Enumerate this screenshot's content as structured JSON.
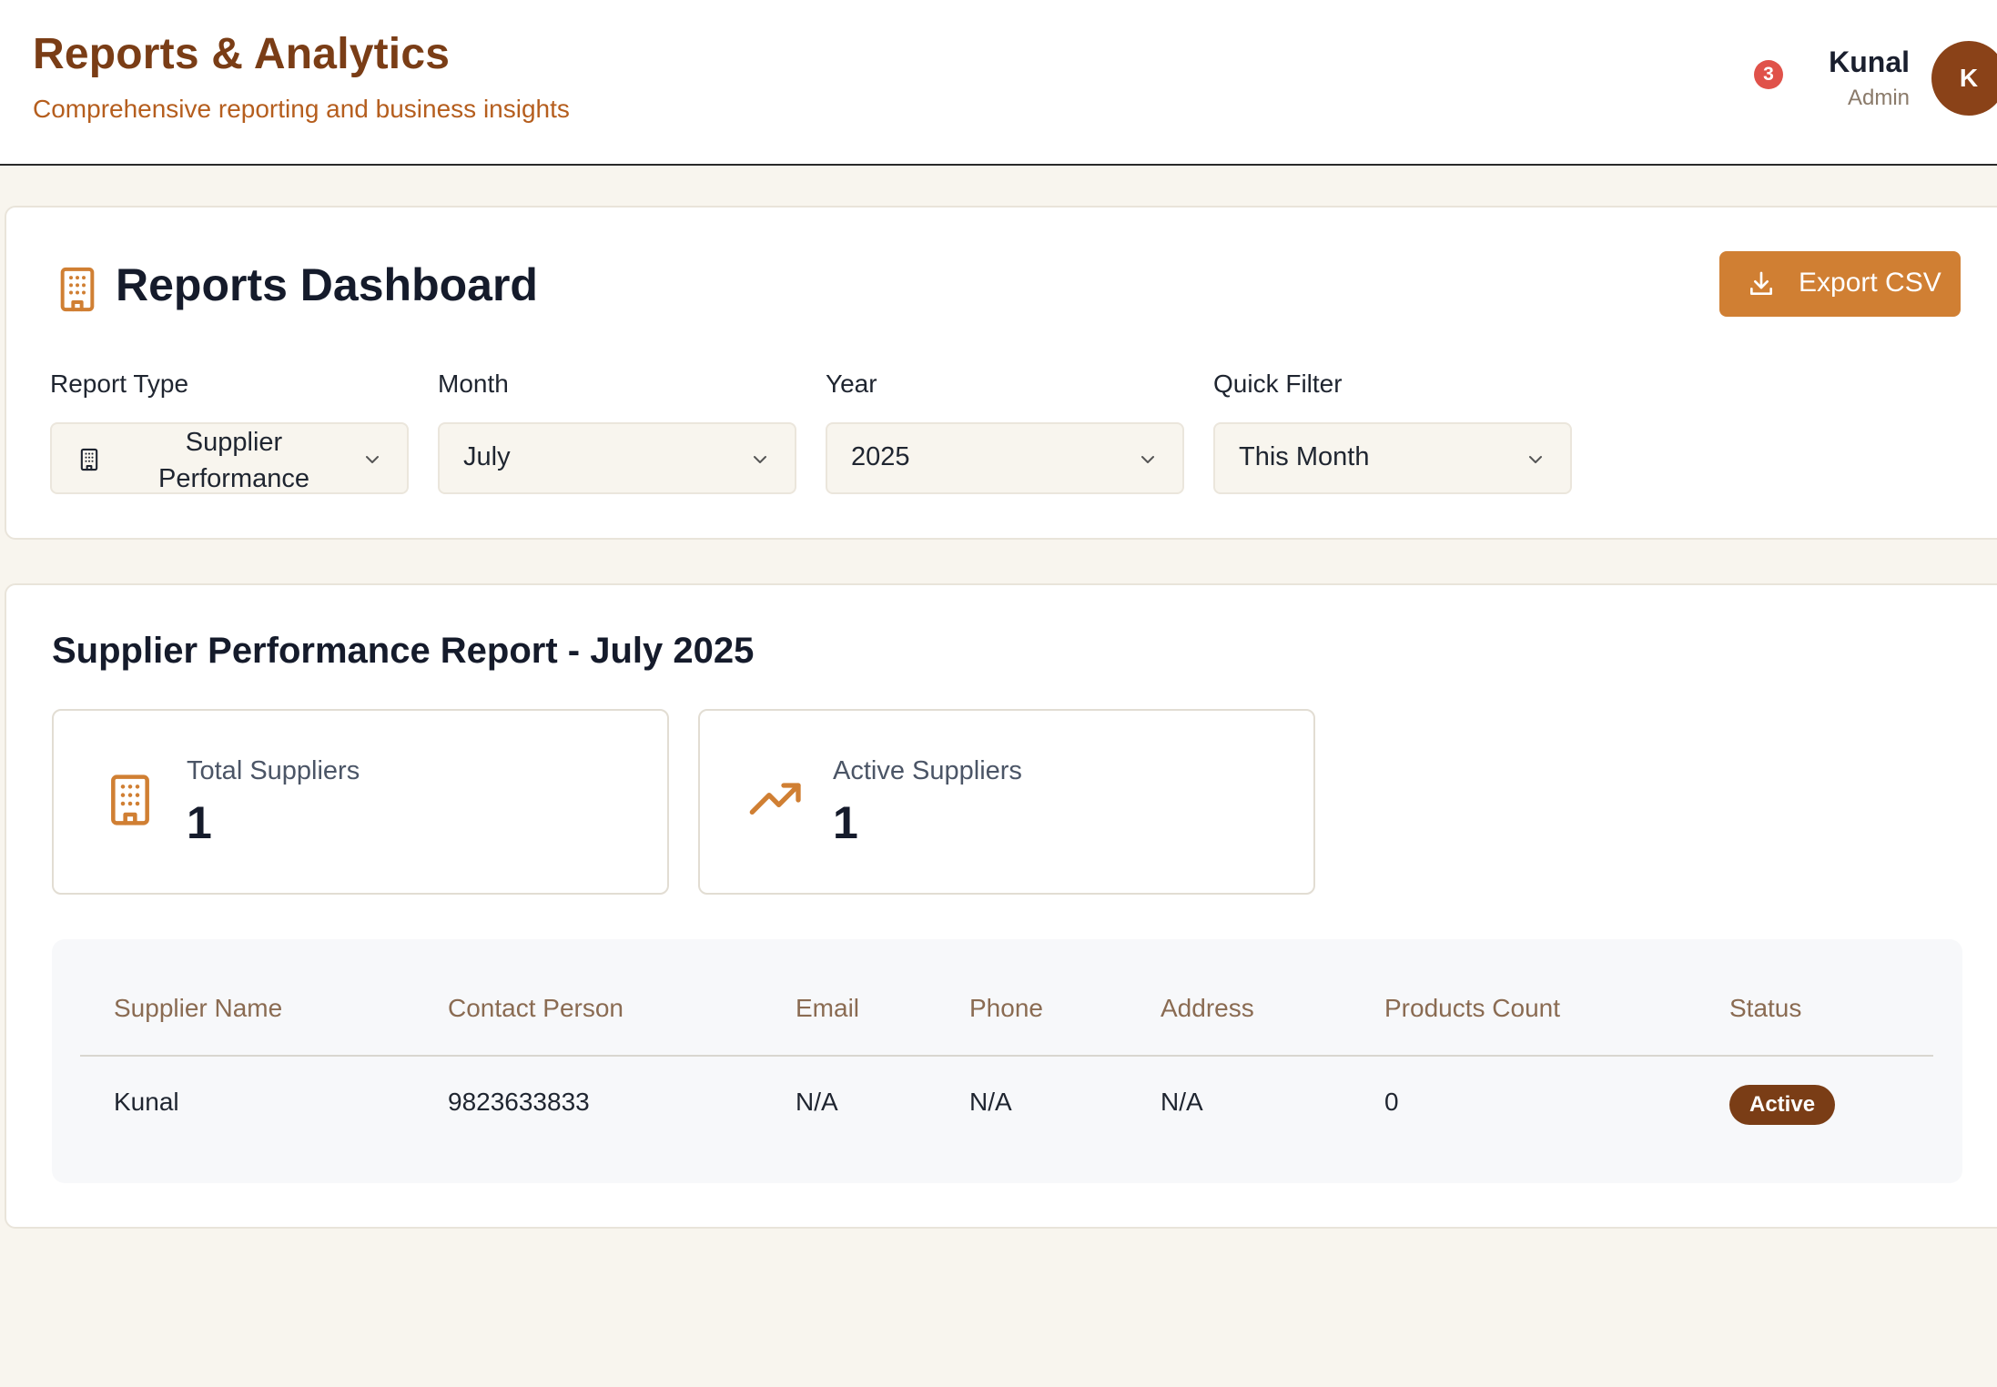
{
  "header": {
    "title": "Reports & Analytics",
    "subtitle": "Comprehensive reporting and business insights",
    "notification_count": "3",
    "user": {
      "name": "Kunal",
      "role": "Admin",
      "initial": "K"
    }
  },
  "dashboard": {
    "title": "Reports Dashboard",
    "export_label": "Export CSV",
    "filters": [
      {
        "label": "Report Type",
        "value": "Supplier Performance"
      },
      {
        "label": "Month",
        "value": "July"
      },
      {
        "label": "Year",
        "value": "2025"
      },
      {
        "label": "Quick Filter",
        "value": "This Month"
      }
    ]
  },
  "report": {
    "title": "Supplier Performance Report - July 2025",
    "stats": [
      {
        "label": "Total Suppliers",
        "value": "1",
        "icon": "building-icon"
      },
      {
        "label": "Active Suppliers",
        "value": "1",
        "icon": "trending-up-icon"
      }
    ],
    "table": {
      "columns": [
        "Supplier Name",
        "Contact Person",
        "Email",
        "Phone",
        "Address",
        "Products Count",
        "Status"
      ],
      "rows": [
        [
          "Kunal",
          "9823633833",
          "N/A",
          "N/A",
          "N/A",
          "0",
          "Active"
        ]
      ]
    }
  },
  "colors": {
    "brand_dark": "#7a3d16",
    "accent": "#d07f33",
    "background": "#f8f5ee",
    "badge_red": "#e0524a"
  }
}
